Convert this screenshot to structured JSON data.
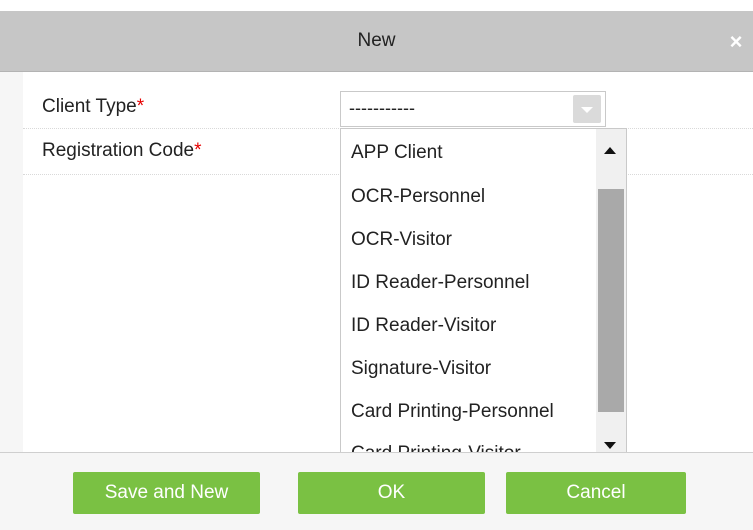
{
  "dialog": {
    "title": "New",
    "close_glyph": "×"
  },
  "form": {
    "client_type": {
      "label": "Client Type",
      "required_mark": "*",
      "value": "-----------"
    },
    "registration_code": {
      "label": "Registration Code",
      "required_mark": "*"
    }
  },
  "dropdown": {
    "options": [
      "APP Client",
      "OCR-Personnel",
      "OCR-Visitor",
      "ID Reader-Personnel",
      "ID Reader-Visitor",
      "Signature-Visitor",
      "Card Printing-Personnel",
      "Card Printing-Visitor"
    ]
  },
  "footer": {
    "save_and_new_label": "Save and New",
    "ok_label": "OK",
    "cancel_label": "Cancel"
  },
  "colors": {
    "accent_green": "#7ac143",
    "required_red": "#e60000",
    "titlebar_gray": "#c6c6c6"
  },
  "icons": {
    "close": "close-icon",
    "select_arrow": "chevron-down-icon",
    "scroll_up": "scroll-up-arrow-icon",
    "scroll_down": "scroll-down-arrow-icon"
  }
}
